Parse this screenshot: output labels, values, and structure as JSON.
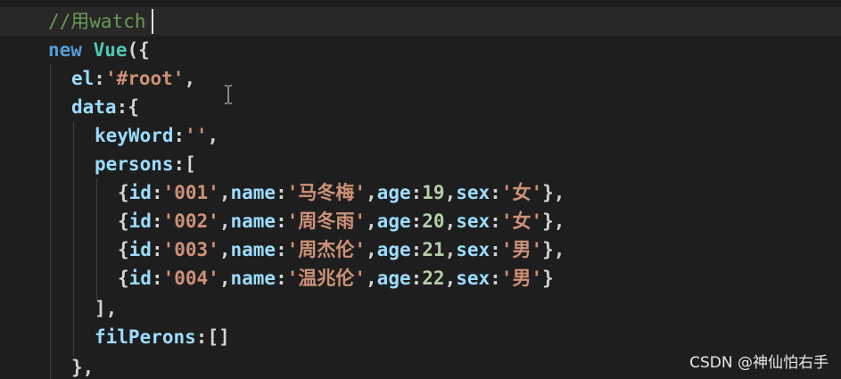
{
  "editor": {
    "lines": [
      [
        {
          "t": "//用watch",
          "c": "comment"
        }
      ],
      [
        {
          "t": "new",
          "c": "keyword"
        },
        {
          "t": " ",
          "c": "punc"
        },
        {
          "t": "Vue",
          "c": "class"
        },
        {
          "t": "({",
          "c": "punc"
        }
      ],
      [
        {
          "t": "el",
          "c": "prop"
        },
        {
          "t": ":",
          "c": "punc"
        },
        {
          "t": "'#root'",
          "c": "string"
        },
        {
          "t": ",",
          "c": "punc"
        }
      ],
      [
        {
          "t": "data",
          "c": "prop"
        },
        {
          "t": ":{",
          "c": "punc"
        }
      ],
      [
        {
          "t": "keyWord",
          "c": "prop"
        },
        {
          "t": ":",
          "c": "punc"
        },
        {
          "t": "''",
          "c": "string"
        },
        {
          "t": ",",
          "c": "punc"
        }
      ],
      [
        {
          "t": "persons",
          "c": "prop"
        },
        {
          "t": ":[",
          "c": "punc"
        }
      ],
      [
        {
          "t": "{",
          "c": "punc"
        },
        {
          "t": "id",
          "c": "prop"
        },
        {
          "t": ":",
          "c": "punc"
        },
        {
          "t": "'001'",
          "c": "string"
        },
        {
          "t": ",",
          "c": "punc"
        },
        {
          "t": "name",
          "c": "prop"
        },
        {
          "t": ":",
          "c": "punc"
        },
        {
          "t": "'马冬梅'",
          "c": "string"
        },
        {
          "t": ",",
          "c": "punc"
        },
        {
          "t": "age",
          "c": "prop"
        },
        {
          "t": ":",
          "c": "punc"
        },
        {
          "t": "19",
          "c": "number"
        },
        {
          "t": ",",
          "c": "punc"
        },
        {
          "t": "sex",
          "c": "prop"
        },
        {
          "t": ":",
          "c": "punc"
        },
        {
          "t": "'女'",
          "c": "string"
        },
        {
          "t": "},",
          "c": "punc"
        }
      ],
      [
        {
          "t": "{",
          "c": "punc"
        },
        {
          "t": "id",
          "c": "prop"
        },
        {
          "t": ":",
          "c": "punc"
        },
        {
          "t": "'002'",
          "c": "string"
        },
        {
          "t": ",",
          "c": "punc"
        },
        {
          "t": "name",
          "c": "prop"
        },
        {
          "t": ":",
          "c": "punc"
        },
        {
          "t": "'周冬雨'",
          "c": "string"
        },
        {
          "t": ",",
          "c": "punc"
        },
        {
          "t": "age",
          "c": "prop"
        },
        {
          "t": ":",
          "c": "punc"
        },
        {
          "t": "20",
          "c": "number"
        },
        {
          "t": ",",
          "c": "punc"
        },
        {
          "t": "sex",
          "c": "prop"
        },
        {
          "t": ":",
          "c": "punc"
        },
        {
          "t": "'女'",
          "c": "string"
        },
        {
          "t": "},",
          "c": "punc"
        }
      ],
      [
        {
          "t": "{",
          "c": "punc"
        },
        {
          "t": "id",
          "c": "prop"
        },
        {
          "t": ":",
          "c": "punc"
        },
        {
          "t": "'003'",
          "c": "string"
        },
        {
          "t": ",",
          "c": "punc"
        },
        {
          "t": "name",
          "c": "prop"
        },
        {
          "t": ":",
          "c": "punc"
        },
        {
          "t": "'周杰伦'",
          "c": "string"
        },
        {
          "t": ",",
          "c": "punc"
        },
        {
          "t": "age",
          "c": "prop"
        },
        {
          "t": ":",
          "c": "punc"
        },
        {
          "t": "21",
          "c": "number"
        },
        {
          "t": ",",
          "c": "punc"
        },
        {
          "t": "sex",
          "c": "prop"
        },
        {
          "t": ":",
          "c": "punc"
        },
        {
          "t": "'男'",
          "c": "string"
        },
        {
          "t": "},",
          "c": "punc"
        }
      ],
      [
        {
          "t": "{",
          "c": "punc"
        },
        {
          "t": "id",
          "c": "prop"
        },
        {
          "t": ":",
          "c": "punc"
        },
        {
          "t": "'004'",
          "c": "string"
        },
        {
          "t": ",",
          "c": "punc"
        },
        {
          "t": "name",
          "c": "prop"
        },
        {
          "t": ":",
          "c": "punc"
        },
        {
          "t": "'温兆伦'",
          "c": "string"
        },
        {
          "t": ",",
          "c": "punc"
        },
        {
          "t": "age",
          "c": "prop"
        },
        {
          "t": ":",
          "c": "punc"
        },
        {
          "t": "22",
          "c": "number"
        },
        {
          "t": ",",
          "c": "punc"
        },
        {
          "t": "sex",
          "c": "prop"
        },
        {
          "t": ":",
          "c": "punc"
        },
        {
          "t": "'男'",
          "c": "string"
        },
        {
          "t": "}",
          "c": "punc"
        }
      ],
      [
        {
          "t": "],",
          "c": "punc"
        }
      ],
      [
        {
          "t": "filPerons",
          "c": "prop"
        },
        {
          "t": ":[]",
          "c": "punc"
        }
      ],
      [
        {
          "t": "},",
          "c": "punc"
        }
      ]
    ]
  },
  "watermark": {
    "text": "CSDN @神仙怕右手"
  },
  "colors": {
    "background": "#1e1e1e",
    "comment": "#6a9955",
    "keyword": "#569cd6",
    "class": "#4ec9b0",
    "property": "#9cdcfe",
    "string": "#ce9178",
    "number": "#b5cea8",
    "punctuation": "#d4d4d4"
  },
  "icons": {
    "mouse_pointer": "ibeam-cursor-icon"
  }
}
